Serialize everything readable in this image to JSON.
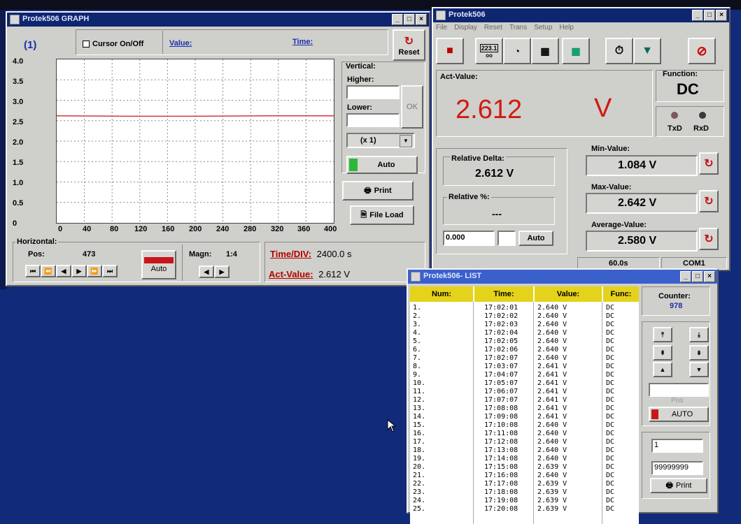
{
  "graph_window": {
    "title": "Protek506 GRAPH",
    "channel_label": "(1)",
    "cursor_label": "Cursor On/Off",
    "value_label": "Value:",
    "time_label": "Time:",
    "reset_label": "Reset",
    "vertical_label": "Vertical:",
    "higher_label": "Higher:",
    "lower_label": "Lower:",
    "higher_value": "",
    "lower_value": "",
    "ok_label": "OK",
    "scale_select": "(x 1)",
    "auto_label": "Auto",
    "print_label": "Print",
    "file_load_label": "File Load",
    "horizontal_label": "Horizontal:",
    "pos_label": "Pos:",
    "pos_value": "473",
    "auto2_label": "Auto",
    "magn_label": "Magn:",
    "magn_value": "1:4",
    "time_div_label": "Time/DIV:",
    "time_div_value": "2400.0 s",
    "act_value_label": "Act-Value:",
    "act_value": "2.612 V"
  },
  "chart_data": {
    "type": "line",
    "title": "",
    "xlabel": "",
    "ylabel": "",
    "x_ticks": [
      "0",
      "40",
      "80",
      "120",
      "160",
      "200",
      "240",
      "280",
      "320",
      "360",
      "400"
    ],
    "y_ticks": [
      "4.0",
      "3.5",
      "3.0",
      "2.5",
      "2.0",
      "1.5",
      "1.0",
      "0.5",
      "0"
    ],
    "xlim": [
      0,
      400
    ],
    "ylim": [
      0,
      4
    ],
    "grid": true,
    "series": [
      {
        "x": [
          0,
          100,
          200,
          300,
          400
        ],
        "y": [
          2.62,
          2.61,
          2.61,
          2.62,
          2.62
        ],
        "color": "#d03a3a"
      }
    ]
  },
  "main_window": {
    "title": "Protek506",
    "menu": [
      "File",
      "Display",
      "Reset",
      "Trans",
      "Setup",
      "Help"
    ],
    "act_value_label": "Act-Value:",
    "act_value": "2.612",
    "act_unit": "V",
    "function_label": "Function:",
    "function_value": "DC",
    "txd_label": "TxD",
    "rxd_label": "RxD",
    "rel_delta_label": "Relative Delta:",
    "rel_delta_value": "2.612 V",
    "rel_pct_label": "Relative %:",
    "rel_pct_value": "---",
    "offset_value": "0.000",
    "auto_label": "Auto",
    "min_label": "Min-Value:",
    "min_value": "1.084 V",
    "max_label": "Max-Value:",
    "max_value": "2.642 V",
    "avg_label": "Average-Value:",
    "avg_value": "2.580 V",
    "interval": "60.0s",
    "port": "COM1",
    "toolbar_display": "223.1"
  },
  "list_window": {
    "title": "Protek506- LIST",
    "columns": [
      "Num:",
      "Time:",
      "Value:",
      "Func:"
    ],
    "counter_label": "Counter:",
    "counter_value": "978",
    "pos_label": "Pos",
    "auto_label": "AUTO",
    "from_value": "1",
    "to_value": "99999999",
    "print_label": "Print",
    "rows": [
      {
        "num": "1.",
        "time": "17:02:01",
        "value": "2.640 V",
        "func": "DC"
      },
      {
        "num": "2.",
        "time": "17:02:02",
        "value": "2.640 V",
        "func": "DC"
      },
      {
        "num": "3.",
        "time": "17:02:03",
        "value": "2.640 V",
        "func": "DC"
      },
      {
        "num": "4.",
        "time": "17:02:04",
        "value": "2.640 V",
        "func": "DC"
      },
      {
        "num": "5.",
        "time": "17:02:05",
        "value": "2.640 V",
        "func": "DC"
      },
      {
        "num": "6.",
        "time": "17:02:06",
        "value": "2.640 V",
        "func": "DC"
      },
      {
        "num": "7.",
        "time": "17:02:07",
        "value": "2.640 V",
        "func": "DC"
      },
      {
        "num": "8.",
        "time": "17:03:07",
        "value": "2.641 V",
        "func": "DC"
      },
      {
        "num": "9.",
        "time": "17:04:07",
        "value": "2.641 V",
        "func": "DC"
      },
      {
        "num": "10.",
        "time": "17:05:07",
        "value": "2.641 V",
        "func": "DC"
      },
      {
        "num": "11.",
        "time": "17:06:07",
        "value": "2.641 V",
        "func": "DC"
      },
      {
        "num": "12.",
        "time": "17:07:07",
        "value": "2.641 V",
        "func": "DC"
      },
      {
        "num": "13.",
        "time": "17:08:08",
        "value": "2.641 V",
        "func": "DC"
      },
      {
        "num": "14.",
        "time": "17:09:08",
        "value": "2.641 V",
        "func": "DC"
      },
      {
        "num": "15.",
        "time": "17:10:08",
        "value": "2.640 V",
        "func": "DC"
      },
      {
        "num": "16.",
        "time": "17:11:08",
        "value": "2.640 V",
        "func": "DC"
      },
      {
        "num": "17.",
        "time": "17:12:08",
        "value": "2.640 V",
        "func": "DC"
      },
      {
        "num": "18.",
        "time": "17:13:08",
        "value": "2.640 V",
        "func": "DC"
      },
      {
        "num": "19.",
        "time": "17:14:08",
        "value": "2.640 V",
        "func": "DC"
      },
      {
        "num": "20.",
        "time": "17:15:08",
        "value": "2.639 V",
        "func": "DC"
      },
      {
        "num": "21.",
        "time": "17:16:08",
        "value": "2.640 V",
        "func": "DC"
      },
      {
        "num": "22.",
        "time": "17:17:08",
        "value": "2.639 V",
        "func": "DC"
      },
      {
        "num": "23.",
        "time": "17:18:08",
        "value": "2.639 V",
        "func": "DC"
      },
      {
        "num": "24.",
        "time": "17:19:08",
        "value": "2.639 V",
        "func": "DC"
      },
      {
        "num": "25.",
        "time": "17:20:08",
        "value": "2.639 V",
        "func": "DC"
      }
    ]
  },
  "colors": {
    "desktop": "#122a7a",
    "title_bar": "#0e2570",
    "measurement_red": "#d11a12",
    "list_header": "#e5d21a",
    "status_green": "#2db83a"
  }
}
